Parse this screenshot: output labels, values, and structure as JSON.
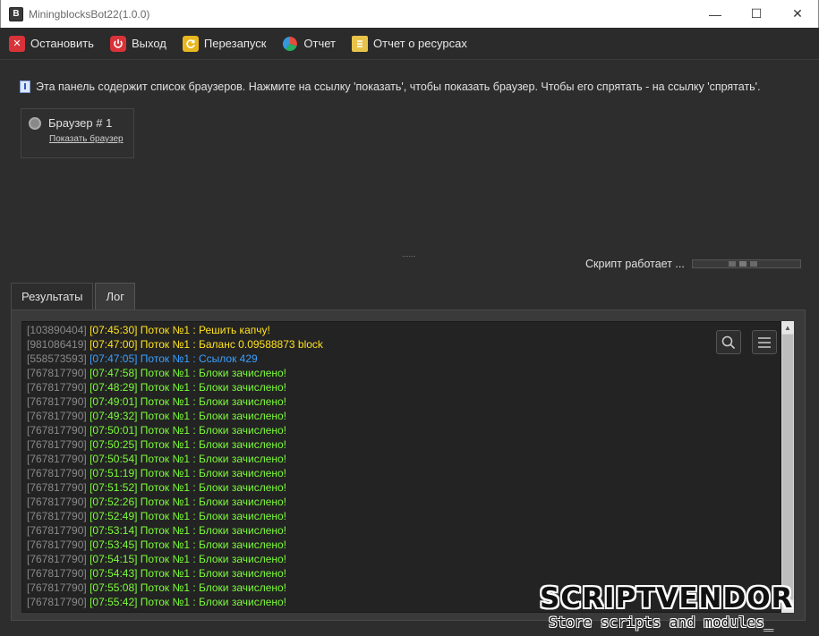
{
  "window": {
    "title": "MiningblocksBot22(1.0.0)",
    "minimize": "—",
    "maximize": "☐",
    "close": "✕"
  },
  "toolbar": {
    "stop": "Остановить",
    "exit": "Выход",
    "restart": "Перезапуск",
    "report": "Отчет",
    "resource_report": "Отчет о ресурсах"
  },
  "info_text": "Эта панель содержит список браузеров. Нажмите на ссылку 'показать', чтобы показать браузер. Чтобы его спрятать - на ссылку 'спрятать'.",
  "browser": {
    "name": "Браузер # 1",
    "show_link": "Показать браузер"
  },
  "splitter": "......",
  "status_text": "Скрипт работает ...",
  "tabs": [
    {
      "label": "Результаты"
    },
    {
      "label": "Лог"
    }
  ],
  "log": [
    {
      "id": "[103890404]",
      "text": "[07:45:30] Поток №1 : Решить капчу!",
      "color": "#ffe21f"
    },
    {
      "id": "[981086419]",
      "text": "[07:47:00] Поток №1 : Баланс 0.09588873 block",
      "color": "#ffe21f"
    },
    {
      "id": "[558573593]",
      "text": "[07:47:05] Поток №1 : Ссылок 429",
      "color": "#3aa0ff"
    },
    {
      "id": "[767817790]",
      "text": "[07:47:58] Поток №1 : Блоки зачислено!",
      "color": "#7cfc3a"
    },
    {
      "id": "[767817790]",
      "text": "[07:48:29] Поток №1 : Блоки зачислено!",
      "color": "#7cfc3a"
    },
    {
      "id": "[767817790]",
      "text": "[07:49:01] Поток №1 : Блоки зачислено!",
      "color": "#7cfc3a"
    },
    {
      "id": "[767817790]",
      "text": "[07:49:32] Поток №1 : Блоки зачислено!",
      "color": "#7cfc3a"
    },
    {
      "id": "[767817790]",
      "text": "[07:50:01] Поток №1 : Блоки зачислено!",
      "color": "#7cfc3a"
    },
    {
      "id": "[767817790]",
      "text": "[07:50:25] Поток №1 : Блоки зачислено!",
      "color": "#7cfc3a"
    },
    {
      "id": "[767817790]",
      "text": "[07:50:54] Поток №1 : Блоки зачислено!",
      "color": "#7cfc3a"
    },
    {
      "id": "[767817790]",
      "text": "[07:51:19] Поток №1 : Блоки зачислено!",
      "color": "#7cfc3a"
    },
    {
      "id": "[767817790]",
      "text": "[07:51:52] Поток №1 : Блоки зачислено!",
      "color": "#7cfc3a"
    },
    {
      "id": "[767817790]",
      "text": "[07:52:26] Поток №1 : Блоки зачислено!",
      "color": "#7cfc3a"
    },
    {
      "id": "[767817790]",
      "text": "[07:52:49] Поток №1 : Блоки зачислено!",
      "color": "#7cfc3a"
    },
    {
      "id": "[767817790]",
      "text": "[07:53:14] Поток №1 : Блоки зачислено!",
      "color": "#7cfc3a"
    },
    {
      "id": "[767817790]",
      "text": "[07:53:45] Поток №1 : Блоки зачислено!",
      "color": "#7cfc3a"
    },
    {
      "id": "[767817790]",
      "text": "[07:54:15] Поток №1 : Блоки зачислено!",
      "color": "#7cfc3a"
    },
    {
      "id": "[767817790]",
      "text": "[07:54:43] Поток №1 : Блоки зачислено!",
      "color": "#7cfc3a"
    },
    {
      "id": "[767817790]",
      "text": "[07:55:08] Поток №1 : Блоки зачислено!",
      "color": "#7cfc3a"
    },
    {
      "id": "[767817790]",
      "text": "[07:55:42] Поток №1 : Блоки зачислено!",
      "color": "#7cfc3a"
    }
  ],
  "watermark": {
    "logo": "SCRIPTVENDOR",
    "tagline": "Store scripts and modules_"
  },
  "icons": {
    "stop": "x-icon",
    "exit": "power-icon",
    "restart": "refresh-icon",
    "report": "pie-chart-icon",
    "resource_report": "document-icon",
    "search": "search-icon",
    "menu": "hamburger-menu-icon"
  }
}
